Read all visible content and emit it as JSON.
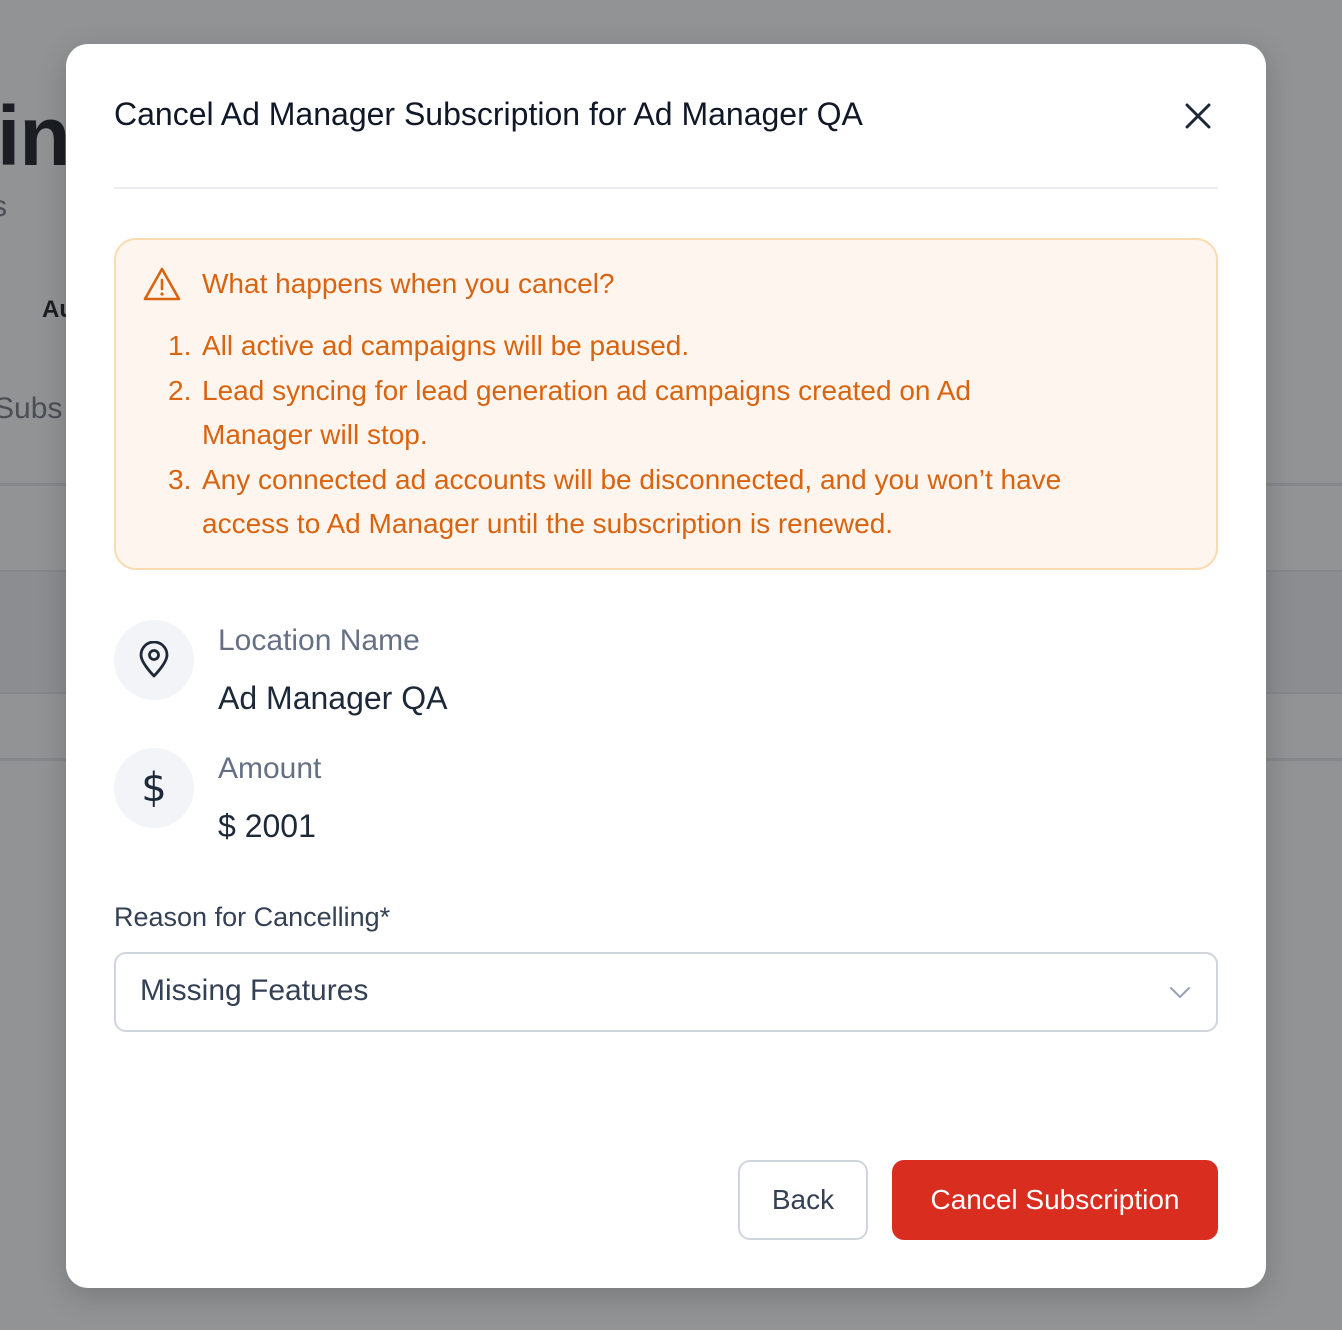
{
  "background": {
    "title_fragment": "tin",
    "subtitle_fragment": "s",
    "tab_fragment": "Au",
    "section_fragment": "Subs"
  },
  "modal": {
    "title": "Cancel Ad Manager Subscription for Ad Manager QA",
    "close_icon": "close-icon"
  },
  "warning": {
    "icon": "warning-triangle-icon",
    "title": "What happens when you cancel?",
    "items": [
      {
        "num": "1.",
        "text": "All active ad campaigns will be paused."
      },
      {
        "num": "2.",
        "text": "Lead syncing for lead generation ad campaigns created on Ad Manager will stop."
      },
      {
        "num": "3.",
        "text": "Any connected ad accounts will be disconnected, and you won’t have access to Ad Manager until the subscription is renewed."
      }
    ]
  },
  "details": {
    "location": {
      "icon": "location-pin-icon",
      "label": "Location Name",
      "value": "Ad Manager QA"
    },
    "amount": {
      "icon": "dollar-icon",
      "icon_glyph": "$",
      "label": "Amount",
      "value": "$ 2001"
    }
  },
  "reason": {
    "label": "Reason for Cancelling*",
    "selected": "Missing Features"
  },
  "footer": {
    "back_label": "Back",
    "cancel_label": "Cancel Subscription"
  },
  "colors": {
    "warning_text": "#d9630f",
    "warning_bg": "#fef6ee",
    "warning_border": "#f9dbaf",
    "danger": "#d92d20",
    "overlay": "#929395"
  }
}
